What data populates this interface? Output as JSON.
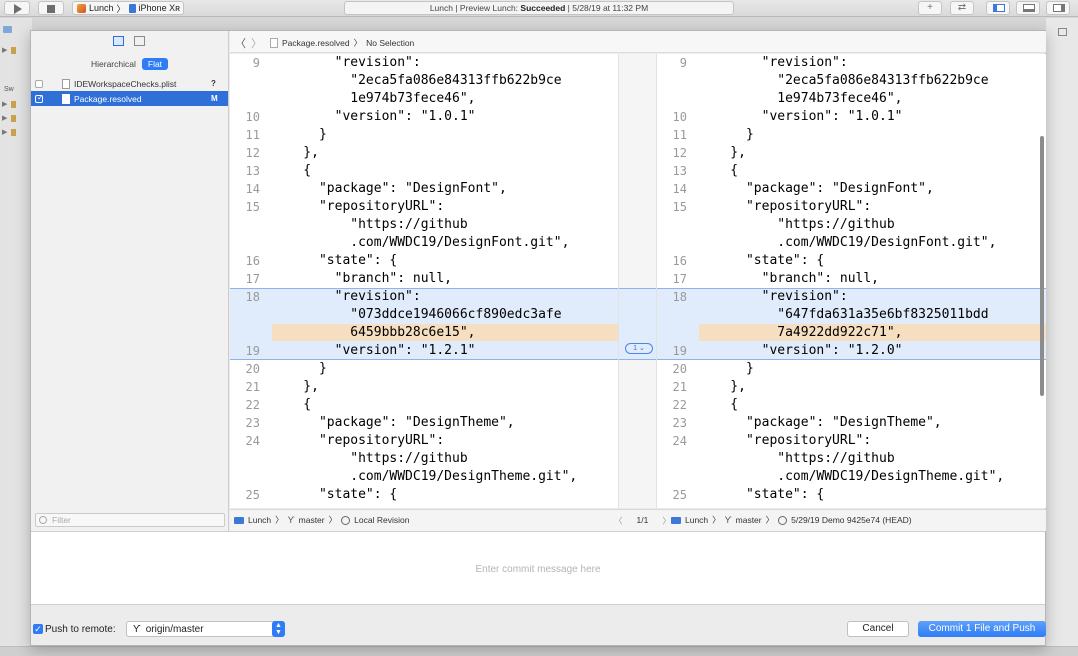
{
  "toolbar": {
    "scheme_app": "Lunch",
    "scheme_device": "iPhone Xʀ",
    "status_prefix": "Lunch | Preview Lunch: ",
    "status_result": "Succeeded",
    "status_time": " | 5/28/19 at 11:32 PM"
  },
  "background": {
    "sidebar_label": "Sw"
  },
  "sidebar": {
    "mode_hierarchical": "Hierarchical",
    "mode_flat": "Flat",
    "files": [
      {
        "name": "IDEWorkspaceChecks.plist",
        "status": "?",
        "checked": false,
        "selected": false
      },
      {
        "name": "Package.resolved",
        "status": "M",
        "checked": true,
        "selected": true
      }
    ],
    "filter_placeholder": "Filter"
  },
  "jumpbar": {
    "file": "Package.resolved",
    "selection": "No Selection"
  },
  "diff": {
    "change_badge": "1 ⌄",
    "left": [
      {
        "n": "9",
        "code": "        \"revision\":"
      },
      {
        "n": "",
        "code": "          \"2eca5fa086e84313ffb622b9ce"
      },
      {
        "n": "",
        "code": "          1e974b73fece46\","
      },
      {
        "n": "10",
        "code": "        \"version\": \"1.0.1\""
      },
      {
        "n": "11",
        "code": "      }"
      },
      {
        "n": "12",
        "code": "    },"
      },
      {
        "n": "13",
        "code": "    {"
      },
      {
        "n": "14",
        "code": "      \"package\": \"DesignFont\","
      },
      {
        "n": "15",
        "code": "      \"repositoryURL\":"
      },
      {
        "n": "",
        "code": "          \"https://github"
      },
      {
        "n": "",
        "code": "          .com/WWDC19/DesignFont.git\","
      },
      {
        "n": "16",
        "code": "      \"state\": {"
      },
      {
        "n": "17",
        "code": "        \"branch\": null,"
      },
      {
        "n": "18",
        "code": "        \"revision\":"
      },
      {
        "n": "",
        "code": "          \"073ddce1946066cf890edc3afe"
      },
      {
        "n": "",
        "code": "          6459bbb28c6e15\","
      },
      {
        "n": "19",
        "code": "        \"version\": \"1.2.1\""
      },
      {
        "n": "20",
        "code": "      }"
      },
      {
        "n": "21",
        "code": "    },"
      },
      {
        "n": "22",
        "code": "    {"
      },
      {
        "n": "23",
        "code": "      \"package\": \"DesignTheme\","
      },
      {
        "n": "24",
        "code": "      \"repositoryURL\":"
      },
      {
        "n": "",
        "code": "          \"https://github"
      },
      {
        "n": "",
        "code": "          .com/WWDC19/DesignTheme.git\","
      },
      {
        "n": "25",
        "code": "      \"state\": {"
      }
    ],
    "right": [
      {
        "n": "9",
        "code": "        \"revision\":"
      },
      {
        "n": "",
        "code": "          \"2eca5fa086e84313ffb622b9ce"
      },
      {
        "n": "",
        "code": "          1e974b73fece46\","
      },
      {
        "n": "10",
        "code": "        \"version\": \"1.0.1\""
      },
      {
        "n": "11",
        "code": "      }"
      },
      {
        "n": "12",
        "code": "    },"
      },
      {
        "n": "13",
        "code": "    {"
      },
      {
        "n": "14",
        "code": "      \"package\": \"DesignFont\","
      },
      {
        "n": "15",
        "code": "      \"repositoryURL\":"
      },
      {
        "n": "",
        "code": "          \"https://github"
      },
      {
        "n": "",
        "code": "          .com/WWDC19/DesignFont.git\","
      },
      {
        "n": "16",
        "code": "      \"state\": {"
      },
      {
        "n": "17",
        "code": "        \"branch\": null,"
      },
      {
        "n": "18",
        "code": "        \"revision\":"
      },
      {
        "n": "",
        "code": "          \"647fda631a35e6bf8325011bdd"
      },
      {
        "n": "",
        "code": "          7a4922dd922c71\","
      },
      {
        "n": "19",
        "code": "        \"version\": \"1.2.0\""
      },
      {
        "n": "20",
        "code": "      }"
      },
      {
        "n": "21",
        "code": "    },"
      },
      {
        "n": "22",
        "code": "    {"
      },
      {
        "n": "23",
        "code": "      \"package\": \"DesignTheme\","
      },
      {
        "n": "24",
        "code": "      \"repositoryURL\":"
      },
      {
        "n": "",
        "code": "          \"https://github"
      },
      {
        "n": "",
        "code": "          .com/WWDC19/DesignTheme.git\","
      },
      {
        "n": "25",
        "code": "      \"state\": {"
      }
    ]
  },
  "pathbar_left": {
    "project": "Lunch",
    "branch": "master",
    "revision": "Local Revision"
  },
  "pathbar_nav": {
    "count": "1/1"
  },
  "pathbar_right": {
    "project": "Lunch",
    "branch": "master",
    "revision": "5/29/19  Demo  9425e74 (HEAD)"
  },
  "commit": {
    "placeholder": "Enter commit message here"
  },
  "bottom": {
    "push_label": "Push to remote:",
    "remote": "origin/master",
    "cancel": "Cancel",
    "commit_button": "Commit 1 File and Push"
  }
}
